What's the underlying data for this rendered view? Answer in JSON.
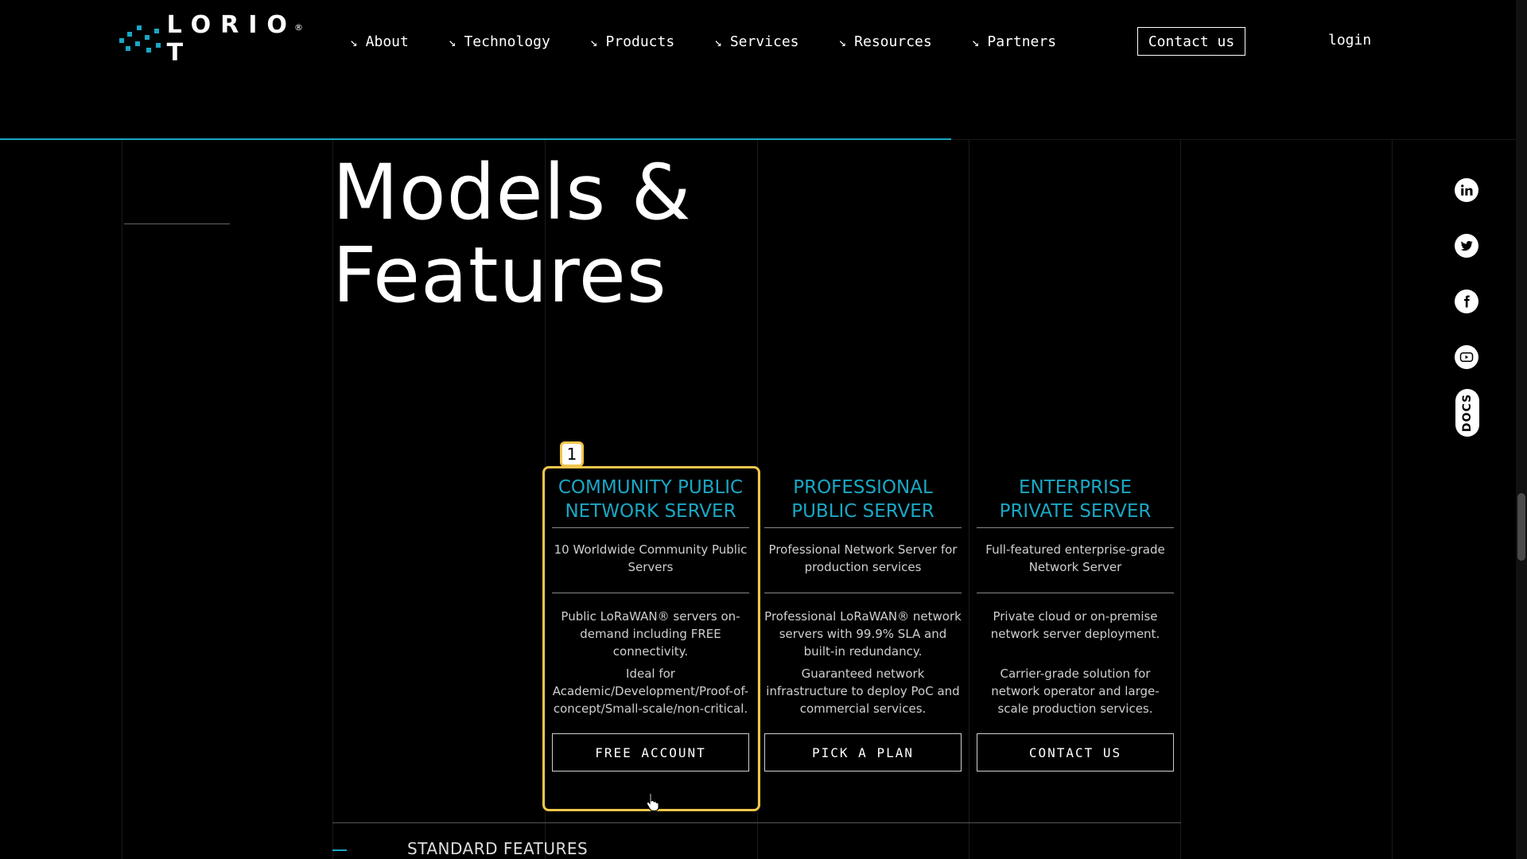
{
  "brand": {
    "name": "LORIOT",
    "display": "LORIO T",
    "registered": "®"
  },
  "nav": {
    "items": [
      {
        "label": "About"
      },
      {
        "label": "Technology"
      },
      {
        "label": "Products"
      },
      {
        "label": "Services"
      },
      {
        "label": "Resources"
      },
      {
        "label": "Partners"
      }
    ],
    "arrow": "↘",
    "contact_label": "Contact us",
    "login_label": "login"
  },
  "page": {
    "title_line1": "Models &",
    "title_line2": "Features"
  },
  "plans": [
    {
      "title_line1": "COMMUNITY PUBLIC",
      "title_line2": "NETWORK SERVER",
      "subtitle": "10 Worldwide Community Public Servers",
      "description": "Public LoRaWAN® servers on-demand including FREE connectivity.",
      "ideal": "Ideal for Academic/Development/Proof-of-concept/Small-scale/non-critical.",
      "button": "FREE ACCOUNT"
    },
    {
      "title_line1": "PROFESSIONAL",
      "title_line2": "PUBLIC SERVER",
      "subtitle": "Professional Network Server for production services",
      "description": "Professional LoRaWAN® network servers with 99.9% SLA and built-in redundancy.",
      "ideal": "Guaranteed network infrastructure to deploy PoC and commercial services.",
      "button": "PICK A PLAN"
    },
    {
      "title_line1": "ENTERPRISE",
      "title_line2": "PRIVATE SERVER",
      "subtitle": "Full-featured enterprise-grade Network Server",
      "description": "Private cloud or on-premise network server deployment.",
      "ideal": "Carrier-grade solution for network operator and large-scale production services.",
      "button": "CONTACT US"
    }
  ],
  "highlight": {
    "badge": "1",
    "color": "#f0c64a"
  },
  "section": {
    "standard_features": "STANDARD FEATURES"
  },
  "social": {
    "items": [
      {
        "icon": "linkedin-icon"
      },
      {
        "icon": "twitter-icon"
      },
      {
        "icon": "facebook-icon"
      },
      {
        "icon": "youtube-icon"
      }
    ],
    "docs_label": "DOCS"
  },
  "colors": {
    "accent": "#1aa7c4",
    "background": "#000000",
    "highlight": "#f0c64a"
  }
}
